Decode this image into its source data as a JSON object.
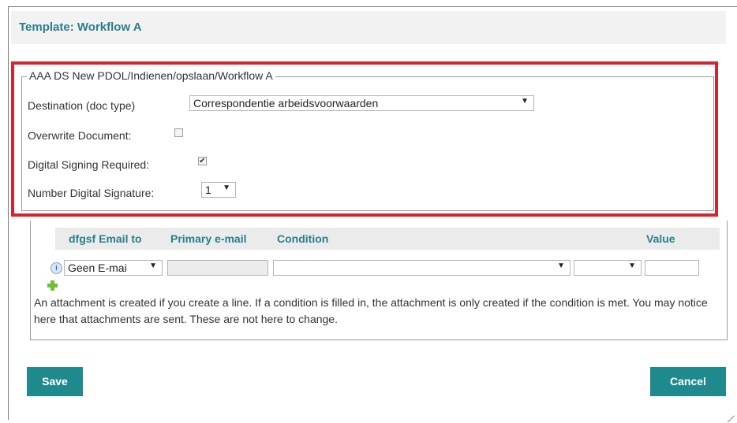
{
  "header": {
    "title": "Template: Workflow A"
  },
  "panel": {
    "legend": "AAA DS New PDOL/Indienen/opslaan/Workflow A",
    "destination_label": "Destination (doc type)",
    "destination_value": "Correspondentie arbeidsvoorwaarden",
    "overwrite_label": "Overwrite Document:",
    "overwrite_checked": false,
    "signing_label": "Digital Signing Required:",
    "signing_checked": true,
    "number_label": "Number Digital Signature:",
    "number_value": "1"
  },
  "table": {
    "columns": [
      "dfgsf Email to",
      "Primary e-mail",
      "Condition",
      "Value"
    ],
    "row": {
      "email_to": "Geen E-mai",
      "primary_email": "",
      "condition": "",
      "operator": "",
      "value": ""
    }
  },
  "note": "An attachment is created if you create a line. If a condition is filled in, the attachment is only created if the condition is met. You may notice here that attachments are sent. These are not here to change.",
  "buttons": {
    "save": "Save",
    "cancel": "Cancel"
  },
  "colors": {
    "accent": "#1f8a8e",
    "title": "#2a7f8c",
    "highlight": "#d8232a"
  }
}
